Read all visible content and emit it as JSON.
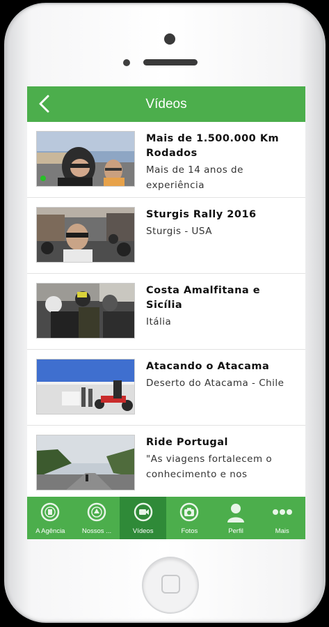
{
  "header": {
    "title": "Vídeos"
  },
  "videos": [
    {
      "title": "Mais de 1.500.000 Km Rodados",
      "subtitle": "Mais de 14 anos de experiência"
    },
    {
      "title": "Sturgis Rally 2016",
      "subtitle": "Sturgis - USA"
    },
    {
      "title": "Costa Amalfitana e Sicília",
      "subtitle": "Itália"
    },
    {
      "title": "Atacando o Atacama",
      "subtitle": "Deserto do Atacama - Chile"
    },
    {
      "title": "Ride Portugal",
      "subtitle": "\"As viagens fortalecem o conhecimento e nos"
    }
  ],
  "tabs": [
    {
      "label": "A Agência",
      "icon": "agency-icon"
    },
    {
      "label": "Nossos ...",
      "icon": "our-trips-icon"
    },
    {
      "label": "Vídeos",
      "icon": "video-icon",
      "active": true
    },
    {
      "label": "Fotos",
      "icon": "camera-icon"
    },
    {
      "label": "Perfil",
      "icon": "profile-icon"
    },
    {
      "label": "Mais",
      "icon": "more-icon"
    }
  ],
  "colors": {
    "brand_green": "#4cae4c",
    "active_tab": "#2f8a38"
  }
}
